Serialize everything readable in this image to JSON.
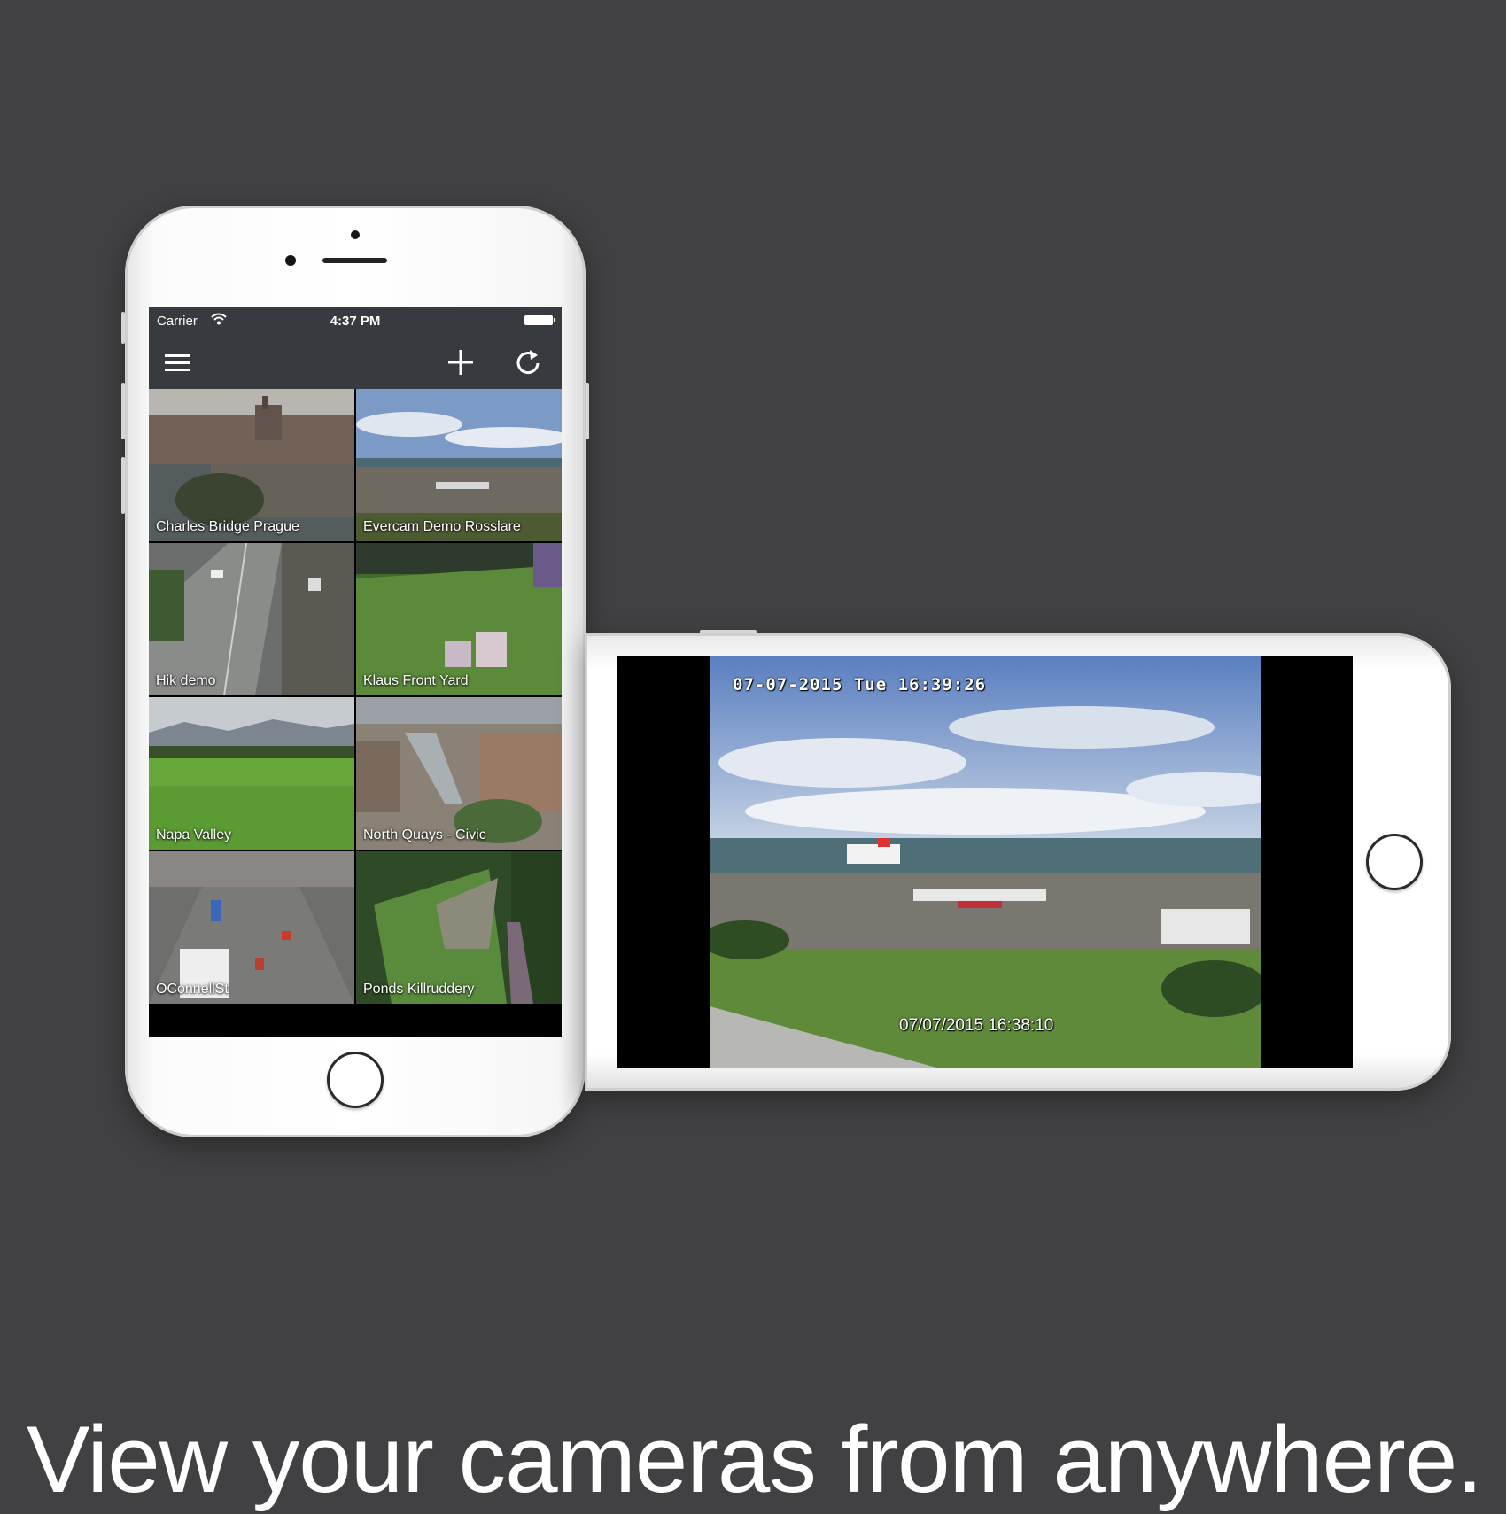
{
  "status_bar": {
    "carrier": "Carrier",
    "time": "4:37 PM"
  },
  "navbar": {
    "menu_icon": "hamburger-menu-icon",
    "add_icon": "plus-icon",
    "refresh_icon": "refresh-icon"
  },
  "cameras": [
    {
      "name": "Charles Bridge Prague"
    },
    {
      "name": "Evercam Demo Rosslare"
    },
    {
      "name": "Hik demo"
    },
    {
      "name": "Klaus Front Yard"
    },
    {
      "name": "Napa Valley"
    },
    {
      "name": "North Quays - Civic"
    },
    {
      "name": "OConnellSt"
    },
    {
      "name": "Ponds Killruddery"
    }
  ],
  "live_view": {
    "osd_timestamp_top": "07-07-2015  Tue  16:39:26",
    "osd_timestamp_bottom": "07/07/2015 16:38:10"
  },
  "tagline": "View your cameras from anywhere.",
  "colors": {
    "background": "#414143",
    "navbar": "#373a3e",
    "phone_body": "#ffffff"
  }
}
